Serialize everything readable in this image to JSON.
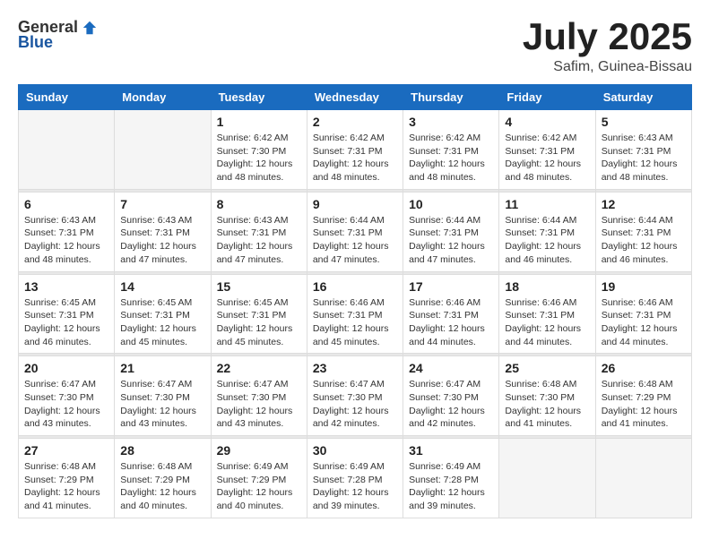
{
  "header": {
    "logo_general": "General",
    "logo_blue": "Blue",
    "month": "July 2025",
    "location": "Safim, Guinea-Bissau"
  },
  "weekdays": [
    "Sunday",
    "Monday",
    "Tuesday",
    "Wednesday",
    "Thursday",
    "Friday",
    "Saturday"
  ],
  "weeks": [
    [
      {
        "day": "",
        "sunrise": "",
        "sunset": "",
        "daylight": ""
      },
      {
        "day": "",
        "sunrise": "",
        "sunset": "",
        "daylight": ""
      },
      {
        "day": "1",
        "sunrise": "Sunrise: 6:42 AM",
        "sunset": "Sunset: 7:30 PM",
        "daylight": "Daylight: 12 hours and 48 minutes."
      },
      {
        "day": "2",
        "sunrise": "Sunrise: 6:42 AM",
        "sunset": "Sunset: 7:31 PM",
        "daylight": "Daylight: 12 hours and 48 minutes."
      },
      {
        "day": "3",
        "sunrise": "Sunrise: 6:42 AM",
        "sunset": "Sunset: 7:31 PM",
        "daylight": "Daylight: 12 hours and 48 minutes."
      },
      {
        "day": "4",
        "sunrise": "Sunrise: 6:42 AM",
        "sunset": "Sunset: 7:31 PM",
        "daylight": "Daylight: 12 hours and 48 minutes."
      },
      {
        "day": "5",
        "sunrise": "Sunrise: 6:43 AM",
        "sunset": "Sunset: 7:31 PM",
        "daylight": "Daylight: 12 hours and 48 minutes."
      }
    ],
    [
      {
        "day": "6",
        "sunrise": "Sunrise: 6:43 AM",
        "sunset": "Sunset: 7:31 PM",
        "daylight": "Daylight: 12 hours and 48 minutes."
      },
      {
        "day": "7",
        "sunrise": "Sunrise: 6:43 AM",
        "sunset": "Sunset: 7:31 PM",
        "daylight": "Daylight: 12 hours and 47 minutes."
      },
      {
        "day": "8",
        "sunrise": "Sunrise: 6:43 AM",
        "sunset": "Sunset: 7:31 PM",
        "daylight": "Daylight: 12 hours and 47 minutes."
      },
      {
        "day": "9",
        "sunrise": "Sunrise: 6:44 AM",
        "sunset": "Sunset: 7:31 PM",
        "daylight": "Daylight: 12 hours and 47 minutes."
      },
      {
        "day": "10",
        "sunrise": "Sunrise: 6:44 AM",
        "sunset": "Sunset: 7:31 PM",
        "daylight": "Daylight: 12 hours and 47 minutes."
      },
      {
        "day": "11",
        "sunrise": "Sunrise: 6:44 AM",
        "sunset": "Sunset: 7:31 PM",
        "daylight": "Daylight: 12 hours and 46 minutes."
      },
      {
        "day": "12",
        "sunrise": "Sunrise: 6:44 AM",
        "sunset": "Sunset: 7:31 PM",
        "daylight": "Daylight: 12 hours and 46 minutes."
      }
    ],
    [
      {
        "day": "13",
        "sunrise": "Sunrise: 6:45 AM",
        "sunset": "Sunset: 7:31 PM",
        "daylight": "Daylight: 12 hours and 46 minutes."
      },
      {
        "day": "14",
        "sunrise": "Sunrise: 6:45 AM",
        "sunset": "Sunset: 7:31 PM",
        "daylight": "Daylight: 12 hours and 45 minutes."
      },
      {
        "day": "15",
        "sunrise": "Sunrise: 6:45 AM",
        "sunset": "Sunset: 7:31 PM",
        "daylight": "Daylight: 12 hours and 45 minutes."
      },
      {
        "day": "16",
        "sunrise": "Sunrise: 6:46 AM",
        "sunset": "Sunset: 7:31 PM",
        "daylight": "Daylight: 12 hours and 45 minutes."
      },
      {
        "day": "17",
        "sunrise": "Sunrise: 6:46 AM",
        "sunset": "Sunset: 7:31 PM",
        "daylight": "Daylight: 12 hours and 44 minutes."
      },
      {
        "day": "18",
        "sunrise": "Sunrise: 6:46 AM",
        "sunset": "Sunset: 7:31 PM",
        "daylight": "Daylight: 12 hours and 44 minutes."
      },
      {
        "day": "19",
        "sunrise": "Sunrise: 6:46 AM",
        "sunset": "Sunset: 7:31 PM",
        "daylight": "Daylight: 12 hours and 44 minutes."
      }
    ],
    [
      {
        "day": "20",
        "sunrise": "Sunrise: 6:47 AM",
        "sunset": "Sunset: 7:30 PM",
        "daylight": "Daylight: 12 hours and 43 minutes."
      },
      {
        "day": "21",
        "sunrise": "Sunrise: 6:47 AM",
        "sunset": "Sunset: 7:30 PM",
        "daylight": "Daylight: 12 hours and 43 minutes."
      },
      {
        "day": "22",
        "sunrise": "Sunrise: 6:47 AM",
        "sunset": "Sunset: 7:30 PM",
        "daylight": "Daylight: 12 hours and 43 minutes."
      },
      {
        "day": "23",
        "sunrise": "Sunrise: 6:47 AM",
        "sunset": "Sunset: 7:30 PM",
        "daylight": "Daylight: 12 hours and 42 minutes."
      },
      {
        "day": "24",
        "sunrise": "Sunrise: 6:47 AM",
        "sunset": "Sunset: 7:30 PM",
        "daylight": "Daylight: 12 hours and 42 minutes."
      },
      {
        "day": "25",
        "sunrise": "Sunrise: 6:48 AM",
        "sunset": "Sunset: 7:30 PM",
        "daylight": "Daylight: 12 hours and 41 minutes."
      },
      {
        "day": "26",
        "sunrise": "Sunrise: 6:48 AM",
        "sunset": "Sunset: 7:29 PM",
        "daylight": "Daylight: 12 hours and 41 minutes."
      }
    ],
    [
      {
        "day": "27",
        "sunrise": "Sunrise: 6:48 AM",
        "sunset": "Sunset: 7:29 PM",
        "daylight": "Daylight: 12 hours and 41 minutes."
      },
      {
        "day": "28",
        "sunrise": "Sunrise: 6:48 AM",
        "sunset": "Sunset: 7:29 PM",
        "daylight": "Daylight: 12 hours and 40 minutes."
      },
      {
        "day": "29",
        "sunrise": "Sunrise: 6:49 AM",
        "sunset": "Sunset: 7:29 PM",
        "daylight": "Daylight: 12 hours and 40 minutes."
      },
      {
        "day": "30",
        "sunrise": "Sunrise: 6:49 AM",
        "sunset": "Sunset: 7:28 PM",
        "daylight": "Daylight: 12 hours and 39 minutes."
      },
      {
        "day": "31",
        "sunrise": "Sunrise: 6:49 AM",
        "sunset": "Sunset: 7:28 PM",
        "daylight": "Daylight: 12 hours and 39 minutes."
      },
      {
        "day": "",
        "sunrise": "",
        "sunset": "",
        "daylight": ""
      },
      {
        "day": "",
        "sunrise": "",
        "sunset": "",
        "daylight": ""
      }
    ]
  ]
}
